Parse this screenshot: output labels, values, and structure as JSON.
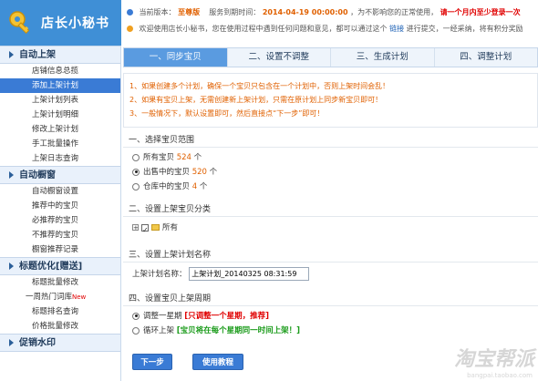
{
  "app": {
    "logo_text": "店长小秘书",
    "brand_color": "#3f8fd6"
  },
  "topbar": {
    "row1": {
      "version_label": "当前版本：",
      "version_value": "至尊版",
      "expire_label": "服务到期时间：",
      "expire_value": "2014-04-19 00:00:00",
      "expire_note": "，为不影响您的正常使用，",
      "warn_text": "请一个月内至少登录一次"
    },
    "row2": {
      "welcome_text": "欢迎使用店长小秘书，您在使用过程中遇到任何问题和意见，都可以通过这个",
      "link_text": "链接",
      "welcome_tail": "进行提交，一经采纳，将有积分奖励"
    }
  },
  "sidebar": {
    "sections": [
      {
        "title": "自动上架",
        "items": [
          {
            "label": "店铺信息总揽",
            "active": false
          },
          {
            "label": "添加上架计划",
            "active": true
          },
          {
            "label": "上架计划列表",
            "active": false
          },
          {
            "label": "上架计划明细",
            "active": false
          },
          {
            "label": "修改上架计划",
            "active": false
          },
          {
            "label": "手工批量操作",
            "active": false
          },
          {
            "label": "上架日志查询",
            "active": false
          }
        ]
      },
      {
        "title": "自动橱窗",
        "items": [
          {
            "label": "自动橱窗设置",
            "active": false
          },
          {
            "label": "推荐中的宝贝",
            "active": false
          },
          {
            "label": "必推荐的宝贝",
            "active": false
          },
          {
            "label": "不推荐的宝贝",
            "active": false
          },
          {
            "label": "橱窗推荐记录",
            "active": false
          }
        ]
      },
      {
        "title": "标题优化[赠送]",
        "items": [
          {
            "label": "标题批量修改",
            "active": false
          },
          {
            "label": "一周热门词库",
            "active": false,
            "badge": "New"
          },
          {
            "label": "标题排名查询",
            "active": false
          },
          {
            "label": "价格批量修改",
            "active": false
          }
        ]
      },
      {
        "title": "促销水印",
        "items": []
      }
    ]
  },
  "steps": [
    {
      "label": "一、同步宝贝",
      "active": true
    },
    {
      "label": "二、设置不调整",
      "active": false
    },
    {
      "label": "三、生成计划",
      "active": false
    },
    {
      "label": "四、调整计划",
      "active": false
    }
  ],
  "notes": [
    "1、如果创建多个计划，确保一个宝贝只包含在一个计划中，否则上架时间会乱！",
    "2、如果有宝贝上架，无需创建新上架计划，只需在原计划上同步新宝贝即可！",
    "3、一般情况下，默认设置即可，然后直接点“下一步”即可！"
  ],
  "range": {
    "title": "一、选择宝贝范围",
    "options": [
      {
        "prefix": "所有宝贝",
        "count": "524",
        "suffix": "个",
        "checked": false
      },
      {
        "prefix": "出售中的宝贝",
        "count": "520",
        "suffix": "个",
        "checked": true
      },
      {
        "prefix": "仓库中的宝贝",
        "count": "4",
        "suffix": "个",
        "checked": false
      }
    ]
  },
  "category": {
    "title": "二、设置上架宝贝分类",
    "tree_label": "所有"
  },
  "plan_name": {
    "title": "三、设置上架计划名称",
    "label": "上架计划名称：",
    "value": "上架计划_20140325 08:31:59"
  },
  "cycle": {
    "title": "四、设置宝贝上架周期",
    "options": [
      {
        "label": "调整一星期",
        "hint": "[只调整一个星期，推荐]",
        "checked": true
      },
      {
        "label": "循环上架",
        "hint": "[宝贝将在每个星期同一时间上架！]",
        "checked": false
      }
    ]
  },
  "buttons": {
    "next": "下一步",
    "tutorial": "使用教程"
  },
  "watermark": {
    "text": "淘宝帮派",
    "url": "bangpai.taobao.com"
  }
}
